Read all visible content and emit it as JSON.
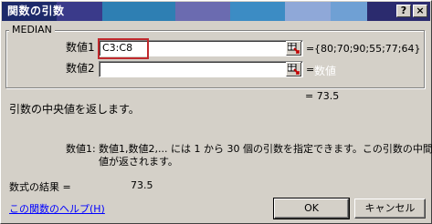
{
  "dialog": {
    "title": "関数の引数",
    "help_glyph": "?",
    "close_glyph": "×"
  },
  "function": {
    "name": "MEDIAN",
    "args": [
      {
        "label": "数値1",
        "value": "C3:C8",
        "result": "{80;70;90;55;77;64}"
      },
      {
        "label": "数値2",
        "value": "",
        "result": "数値"
      }
    ],
    "equals": "=",
    "func_result": "= 73.5",
    "description": "引数の中央値を返します。",
    "arg_help_label": "数値1:",
    "arg_help_text": "数値1,数値2,... には 1 から 30 個の引数を指定できます。この引数の中間",
    "arg_help_text_2": "値が返されます。"
  },
  "formula_result": {
    "label": "数式の結果 =",
    "value": "73.5"
  },
  "footer": {
    "help_link": "この関数のヘルプ(H)",
    "ok_label": "OK",
    "cancel_label": "キャンセル"
  },
  "colors": {
    "face": "#d4d0c8",
    "title_start": "#0a246a",
    "focus_border": "#c0292d",
    "link": "#0000ff",
    "disabled_text": "#ffffff"
  },
  "icons": [
    "range-selector-icon",
    "help-icon",
    "close-icon"
  ]
}
